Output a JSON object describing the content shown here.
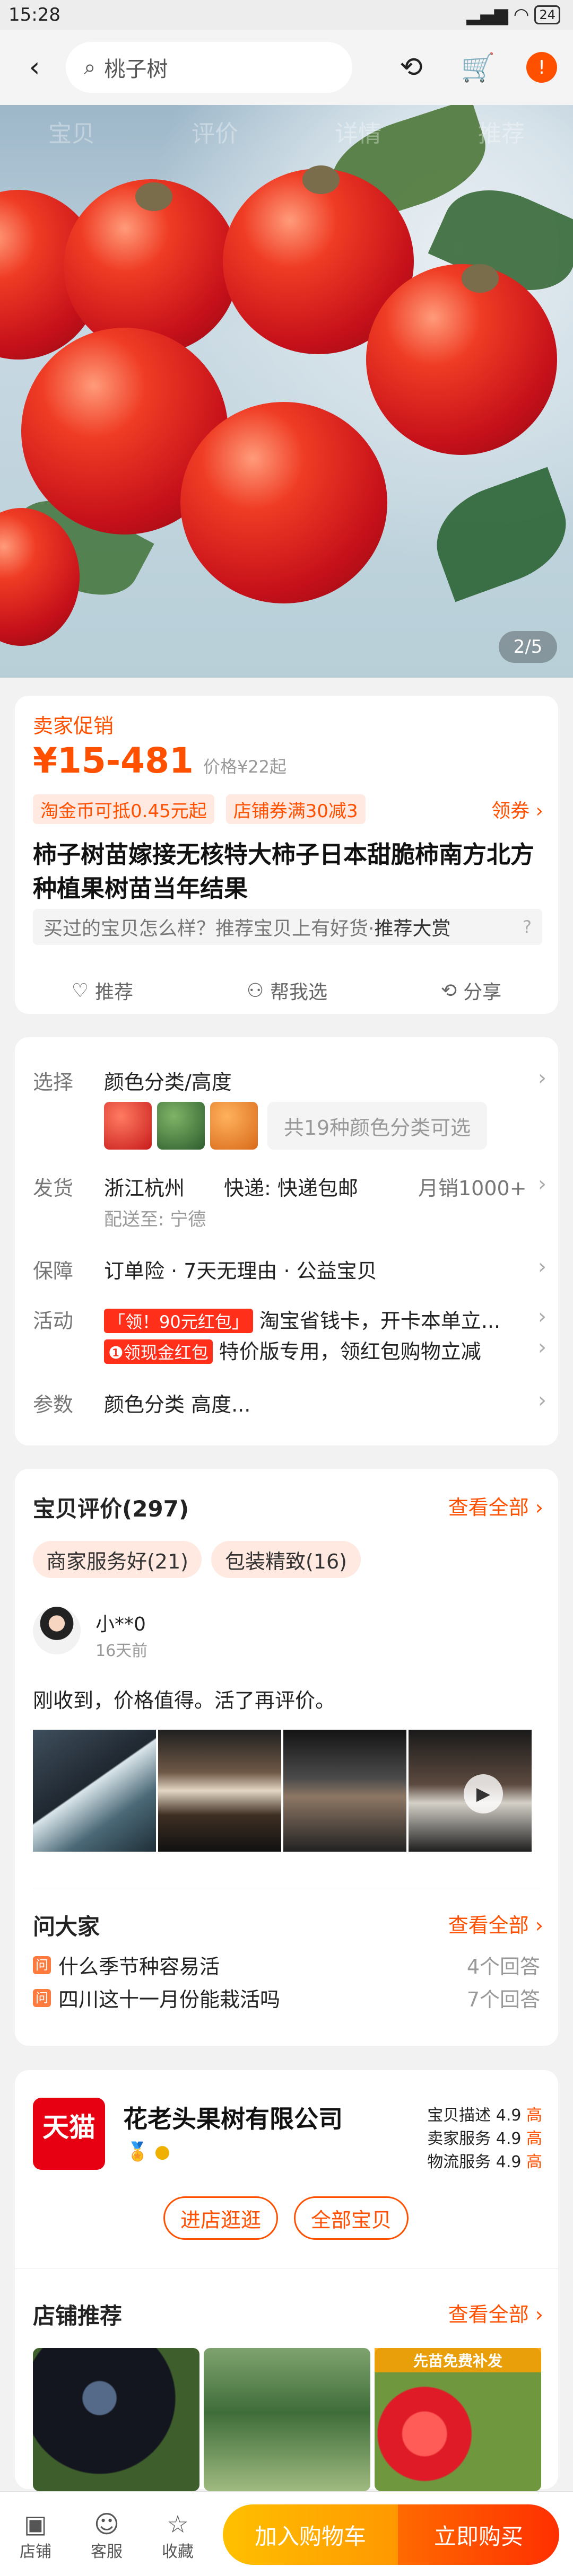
{
  "status": {
    "time": "15:28",
    "battery": "24"
  },
  "search": {
    "query": "桃子树"
  },
  "hero": {
    "tabs": [
      "宝贝",
      "评价",
      "详情",
      "推荐"
    ],
    "counter": "2/5"
  },
  "product": {
    "promo_label": "卖家促销",
    "price": "¥15-481",
    "old_price": "价格¥22起",
    "coupons": [
      "淘金币可抵0.45元起",
      "店铺券满30减3"
    ],
    "coupon_link": "领券 ›",
    "title": "柿子树苗嫁接无核特大柿子日本甜脆柿南方北方种植果树苗当年结果",
    "ask_text": "买过的宝贝怎么样？推荐宝贝上有好货·",
    "ask_strong": "推荐大赏",
    "actions": [
      "推荐",
      "帮我选",
      "分享"
    ]
  },
  "options": {
    "select_label": "选择",
    "select_value": "颜色分类/高度",
    "select_pill": "共19种颜色分类可选",
    "ship_label": "发货",
    "ship_from": "浙江杭州",
    "ship_method": "快递: 快递包邮",
    "monthly_sales": "月销1000+",
    "deliver_to": "配送至: 宁德",
    "guarantee_label": "保障",
    "guarantee_value": "订单险 · 7天无理由 · 公益宝贝",
    "activity_label": "活动",
    "activity_badge1": "「领！90元红包」",
    "activity_text1": "淘宝省钱卡，开卡本单立...",
    "activity_badge2": "❶领现金红包",
    "activity_text2": "特价版专用，领红包购物立减",
    "params_label": "参数",
    "params_value": "颜色分类 高度..."
  },
  "reviews": {
    "title": "宝贝评价(297)",
    "view_all": "查看全部 ›",
    "tags": [
      "商家服务好(21)",
      "包装精致(16)"
    ],
    "user": "小**0",
    "time": "16天前",
    "content": "刚收到，价格值得。活了再评价。"
  },
  "qa": {
    "title": "问大家",
    "view_all": "查看全部 ›",
    "items": [
      {
        "q": "什么季节种容易活",
        "answers": "4个回答"
      },
      {
        "q": "四川这十一月份能栽活吗",
        "answers": "7个回答"
      }
    ]
  },
  "shop": {
    "logo": "天猫",
    "name": "花老头果树有限公司",
    "scores": [
      {
        "label": "宝贝描述",
        "value": "4.9",
        "level": "高"
      },
      {
        "label": "卖家服务",
        "value": "4.9",
        "level": "高"
      },
      {
        "label": "物流服务",
        "value": "4.9",
        "level": "高"
      }
    ],
    "buttons": [
      "进店逛逛",
      "全部宝贝"
    ]
  },
  "shop_rec": {
    "title": "店铺推荐",
    "view_all": "查看全部 ›",
    "banner": "先苗免费补发"
  },
  "bottom": {
    "nav": [
      "店铺",
      "客服",
      "收藏"
    ],
    "cart": "加入购物车",
    "buy": "立即购买"
  }
}
